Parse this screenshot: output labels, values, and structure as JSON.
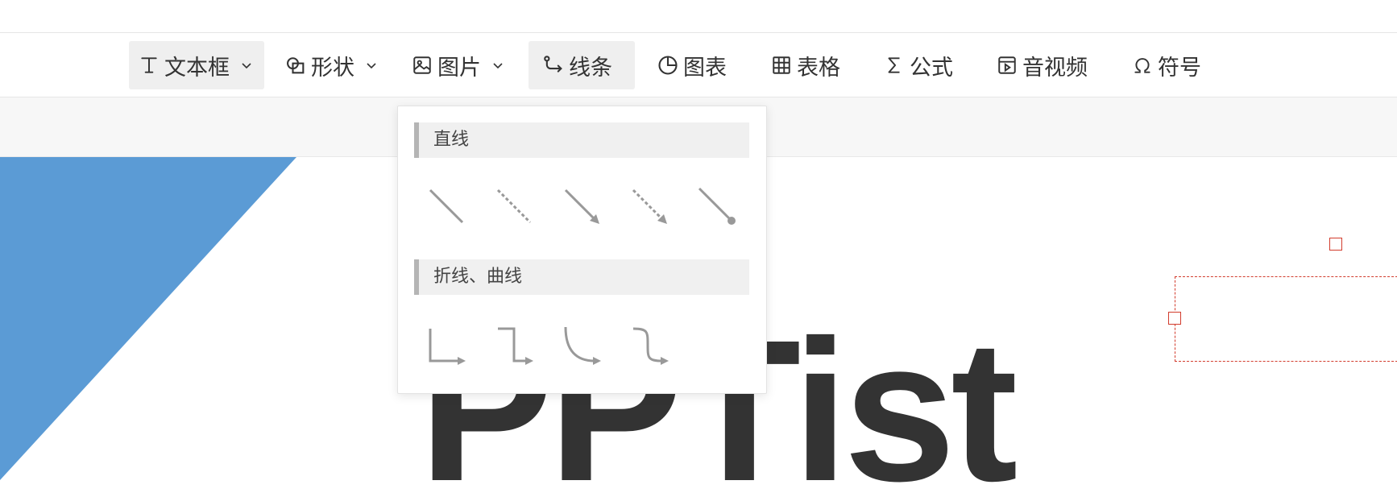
{
  "toolbar": {
    "items": [
      {
        "label": "文本框",
        "icon": "text-cursor-icon",
        "has_caret": true
      },
      {
        "label": "形状",
        "icon": "shape-icon",
        "has_caret": true
      },
      {
        "label": "图片",
        "icon": "image-icon",
        "has_caret": true
      },
      {
        "label": "线条",
        "icon": "connector-line-icon",
        "has_caret": false
      },
      {
        "label": "图表",
        "icon": "pie-chart-icon",
        "has_caret": false
      },
      {
        "label": "表格",
        "icon": "table-grid-icon",
        "has_caret": false
      },
      {
        "label": "公式",
        "icon": "sigma-icon",
        "has_caret": false
      },
      {
        "label": "音视频",
        "icon": "media-icon",
        "has_caret": false
      },
      {
        "label": "符号",
        "icon": "omega-icon",
        "has_caret": false
      }
    ],
    "active_items": [
      "文本框",
      "线条"
    ]
  },
  "line_dropdown": {
    "sections": [
      {
        "title": "直线",
        "options": [
          "straight-line-icon",
          "dashed-line-icon",
          "arrow-line-icon",
          "dashed-arrow-line-icon",
          "dot-end-line-icon"
        ]
      },
      {
        "title": "折线、曲线",
        "options": [
          "elbow-connector-icon",
          "double-elbow-connector-icon",
          "curve-connector-icon",
          "s-curve-connector-icon"
        ]
      }
    ]
  },
  "slide": {
    "title_text": "PPTist",
    "accent_color": "#5b9bd5",
    "text_color": "#333333",
    "selection_color": "#d23c2d"
  }
}
